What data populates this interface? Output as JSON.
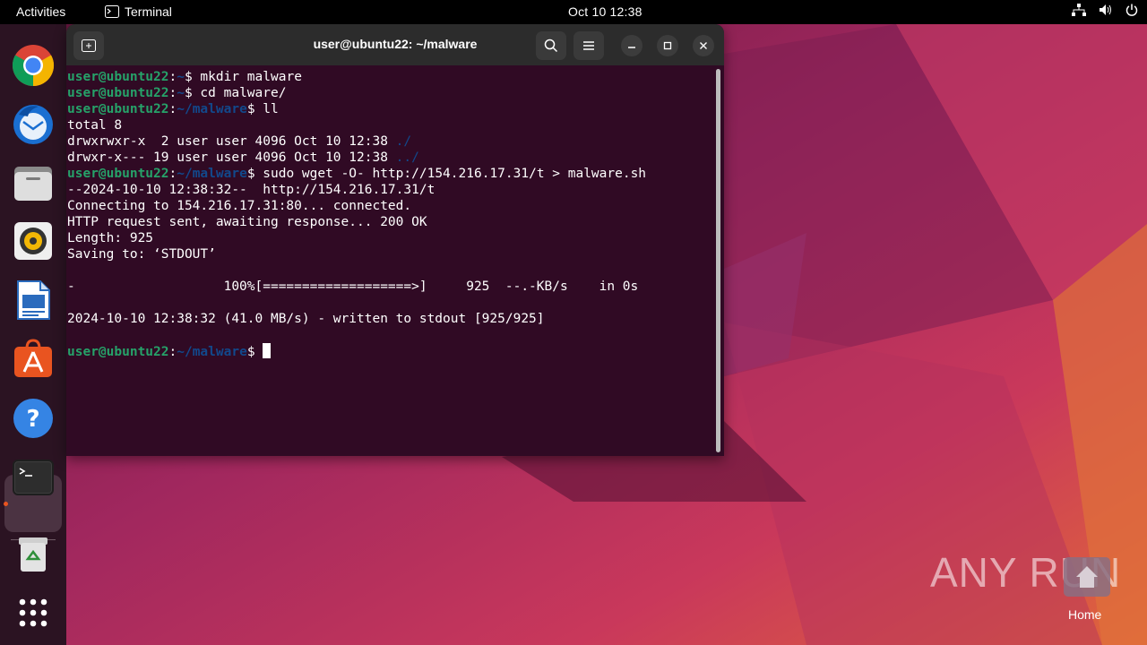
{
  "topbar": {
    "activities": "Activities",
    "app_name": "Terminal",
    "datetime": "Oct 10  12:38"
  },
  "dock": {
    "items": [
      {
        "name": "Google Chrome",
        "icon": "chrome-icon"
      },
      {
        "name": "Thunderbird",
        "icon": "thunderbird-icon"
      },
      {
        "name": "Files",
        "icon": "files-icon"
      },
      {
        "name": "Rhythmbox",
        "icon": "rhythmbox-icon"
      },
      {
        "name": "LibreOffice Writer",
        "icon": "writer-icon"
      },
      {
        "name": "Ubuntu Software",
        "icon": "software-icon"
      },
      {
        "name": "Help",
        "icon": "help-icon"
      },
      {
        "name": "Terminal",
        "icon": "terminal-icon"
      },
      {
        "name": "Trash",
        "icon": "trash-icon"
      },
      {
        "name": "Show Applications",
        "icon": "apps-grid-icon"
      }
    ]
  },
  "terminal": {
    "title": "user@ubuntu22: ~/malware",
    "prompt_user": "user@ubuntu22",
    "lines": [
      {
        "type": "prompt",
        "dir": "~",
        "cmd": " mkdir malware"
      },
      {
        "type": "prompt",
        "dir": "~",
        "cmd": " cd malware/"
      },
      {
        "type": "prompt",
        "dir": "~/malware",
        "cmd": " ll"
      },
      {
        "type": "out",
        "text": "total 8"
      },
      {
        "type": "ls",
        "text": "drwxrwxr-x  2 user user 4096 Oct 10 12:38 ",
        "name": "./"
      },
      {
        "type": "ls",
        "text": "drwxr-x--- 19 user user 4096 Oct 10 12:38 ",
        "name": "../"
      },
      {
        "type": "prompt",
        "dir": "~/malware",
        "cmd": " sudo wget -O- http://154.216.17.31/t > malware.sh"
      },
      {
        "type": "out",
        "text": "--2024-10-10 12:38:32--  http://154.216.17.31/t"
      },
      {
        "type": "out",
        "text": "Connecting to 154.216.17.31:80... connected."
      },
      {
        "type": "out",
        "text": "HTTP request sent, awaiting response... 200 OK"
      },
      {
        "type": "out",
        "text": "Length: 925"
      },
      {
        "type": "out",
        "text": "Saving to: ‘STDOUT’"
      },
      {
        "type": "out",
        "text": ""
      },
      {
        "type": "out",
        "text": "-                   100%[===================>]     925  --.-KB/s    in 0s"
      },
      {
        "type": "out",
        "text": ""
      },
      {
        "type": "out",
        "text": "2024-10-10 12:38:32 (41.0 MB/s) - written to stdout [925/925]"
      },
      {
        "type": "out",
        "text": ""
      },
      {
        "type": "prompt_cursor",
        "dir": "~/malware",
        "cmd": " "
      }
    ]
  },
  "desktop": {
    "watermark": "ANY RUN",
    "home_label": "Home"
  }
}
